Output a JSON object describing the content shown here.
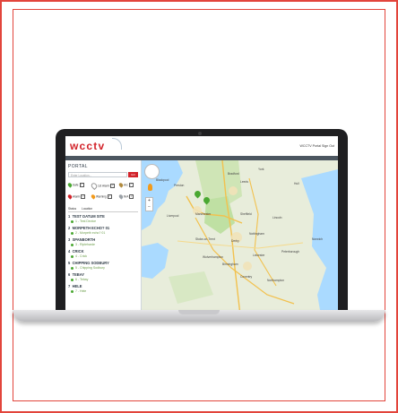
{
  "colors": {
    "brand_red": "#d2232a",
    "nav": "#4c5660",
    "safe": "#4aa832",
    "warning": "#f29a1b"
  },
  "app": {
    "logo": "wcctv",
    "header_links": "WCCTV Portal  Sign Out"
  },
  "sidebar": {
    "title": "PORTAL",
    "search": {
      "placeholder": "Enter Location...",
      "button": "GO"
    },
    "legend": [
      {
        "label": "Safe",
        "color": "#4aa832",
        "icon": "pin-icon"
      },
      {
        "label": "1st Alarm",
        "color": "#ffffff",
        "icon": "pin-icon"
      },
      {
        "label": "Arc",
        "color": "#b08a3e",
        "icon": "pin-icon"
      },
      {
        "label": "Alarm",
        "color": "#d2232a",
        "icon": "pin-icon"
      },
      {
        "label": "Warning",
        "color": "#f29a1b",
        "icon": "pin-icon"
      },
      {
        "label": "N/A",
        "color": "#9aa0a6",
        "icon": "pin-icon"
      }
    ],
    "columns": {
      "status": "Status",
      "location": "Location"
    },
    "sites": [
      {
        "num": "1",
        "name": "TEST DATUM SITE",
        "device": "1 - Test Device"
      },
      {
        "num": "2",
        "name": "MORPETH ECHO? 01",
        "device": "2 - Morpeth echo? 01"
      },
      {
        "num": "3",
        "name": "SPANBORTH",
        "device": "3 - Ripleharde"
      },
      {
        "num": "4",
        "name": "CRICK",
        "device": "4 - Crick"
      },
      {
        "num": "5",
        "name": "CHIPPING SODBURY",
        "device": "5 - Chipping Sodbury"
      },
      {
        "num": "6",
        "name": "TEBAY",
        "device": "6 - Tebay"
      },
      {
        "num": "7",
        "name": "HELE",
        "device": "7 - Hele"
      }
    ]
  },
  "map": {
    "labels": [
      "Bradford",
      "Leeds",
      "York",
      "Hull",
      "Blackpool",
      "Preston",
      "Manchester",
      "Liverpool",
      "Sheffield",
      "Stoke-on-Trent",
      "Derby",
      "Nottingham",
      "Lincoln",
      "Birmingham",
      "Leicester",
      "Peterborough",
      "Norwich",
      "Wolverhampton",
      "Coventry",
      "Northampton"
    ],
    "attribution": "Map data ©2019 Google  Terms of Use  Report a map error"
  }
}
